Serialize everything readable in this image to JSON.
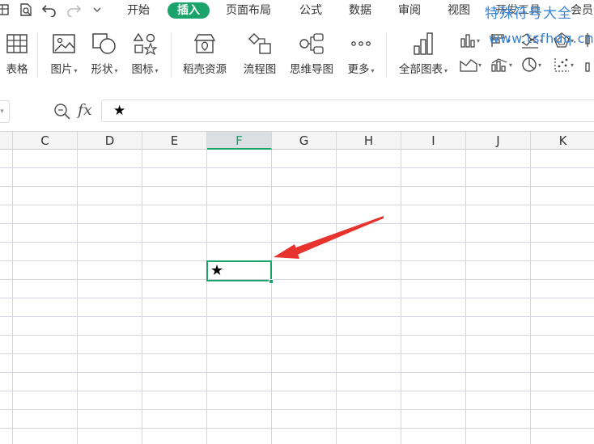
{
  "menu_tabs": [
    {
      "key": "home",
      "label": "开始"
    },
    {
      "key": "insert",
      "label": "插入",
      "active": true
    },
    {
      "key": "layout",
      "label": "页面布局"
    },
    {
      "key": "formula",
      "label": "公式"
    },
    {
      "key": "data",
      "label": "数据"
    },
    {
      "key": "review",
      "label": "审阅"
    },
    {
      "key": "view",
      "label": "视图"
    },
    {
      "key": "devtools",
      "label": "开发工具"
    },
    {
      "key": "member",
      "label": "会员"
    }
  ],
  "watermark": {
    "title": "特殊符号大全",
    "url": "www.tsfhdq.cn"
  },
  "ribbon": {
    "table": "表格",
    "picture": "图片",
    "shape": "形状",
    "icon": "图标",
    "docer": "稻壳资源",
    "flowchart": "流程图",
    "mindmap": "思维导图",
    "more": "更多",
    "all_charts": "全部图表"
  },
  "formula_bar": {
    "fx_label": "fx",
    "value": "★"
  },
  "columns": [
    "C",
    "D",
    "E",
    "F",
    "G",
    "H",
    "I",
    "J",
    "K"
  ],
  "selected_column": "F",
  "selected_cell": {
    "ref": "F7",
    "value": "★"
  },
  "colors": {
    "accent": "#1aa36b",
    "arrow": "#e8322e",
    "watermark": "#3a82d6",
    "grid_line": "#d4d4e4"
  },
  "icons": [
    "sheet-icon",
    "undo-icon",
    "redo-icon",
    "zoom-formula-icon",
    "table-icon",
    "picture-icon",
    "shape-icon",
    "icons-icon",
    "docer-icon",
    "flowchart-icon",
    "mindmap-icon",
    "more-icon",
    "all-charts-icon"
  ]
}
